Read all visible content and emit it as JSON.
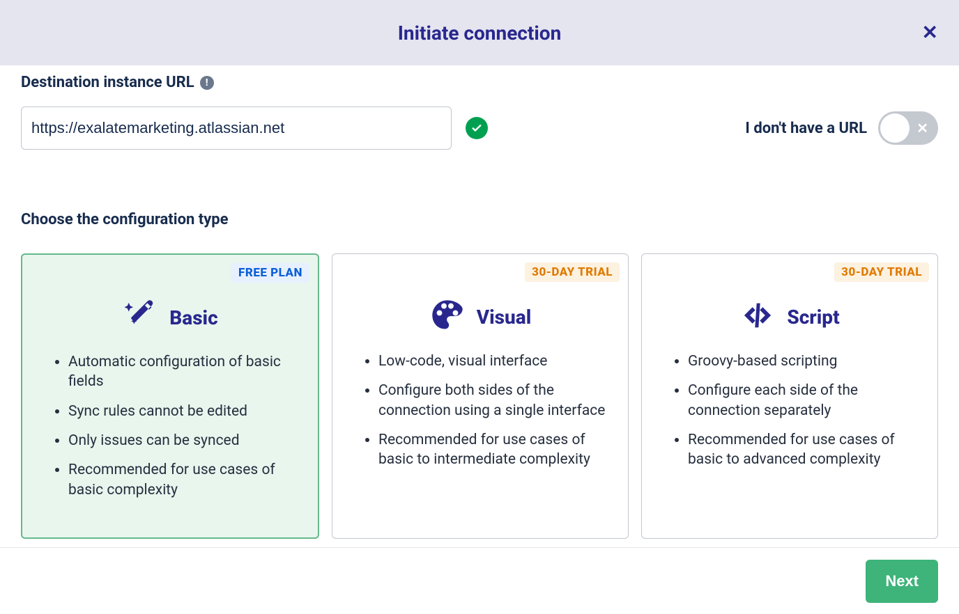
{
  "header": {
    "title": "Initiate connection"
  },
  "url_section": {
    "label": "Destination instance URL",
    "value": "https://exalatemarketing.atlassian.net",
    "no_url_label": "I don't have a URL"
  },
  "config_section": {
    "label": "Choose the configuration type",
    "cards": [
      {
        "badge": "FREE PLAN",
        "title": "Basic",
        "bullets": [
          "Automatic configuration of basic fields",
          "Sync rules cannot be edited",
          "Only issues can be synced",
          "Recommended for use cases of basic complexity"
        ]
      },
      {
        "badge": "30-DAY TRIAL",
        "title": "Visual",
        "bullets": [
          "Low-code, visual interface",
          "Configure both sides of the connection using a single interface",
          "Recommended for use cases of basic to intermediate complexity"
        ]
      },
      {
        "badge": "30-DAY TRIAL",
        "title": "Script",
        "bullets": [
          "Groovy-based scripting",
          "Configure each side of the connection separately",
          "Recommended for use cases of basic to advanced complexity"
        ]
      }
    ]
  },
  "footer": {
    "next_label": "Next"
  }
}
